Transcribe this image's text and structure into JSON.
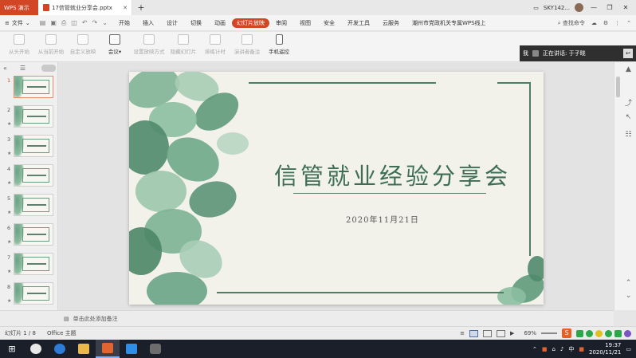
{
  "titlebar": {
    "app_name": "WPS 演示",
    "doc_tab": "17信管就业分享会.pptx",
    "user": "SKY142..."
  },
  "menu": {
    "file": "文件",
    "items": [
      "开始",
      "插入",
      "设计",
      "切换",
      "动画",
      "幻灯片放映",
      "审阅",
      "视图",
      "安全",
      "开发工具",
      "云服务",
      "潮州市党政机关专属WPS线上"
    ],
    "active_index": 5,
    "search": "查找命令"
  },
  "ribbon": {
    "buttons": [
      {
        "label": "从头开始",
        "enabled": false
      },
      {
        "label": "从当前开始",
        "enabled": false
      },
      {
        "label": "自定义放映",
        "enabled": false
      },
      {
        "label": "会议▾",
        "enabled": true
      },
      {
        "label": "设置放映方式",
        "enabled": false
      },
      {
        "label": "隐藏幻灯片",
        "enabled": false
      },
      {
        "label": "排练计时",
        "enabled": false
      },
      {
        "label": "演讲者备注",
        "enabled": false
      },
      {
        "label": "手机遥控",
        "enabled": true
      }
    ]
  },
  "speaker": {
    "me": "我",
    "label": "正在讲话: 于子晓"
  },
  "thumbnails": [
    {
      "num": "1"
    },
    {
      "num": "2"
    },
    {
      "num": "3"
    },
    {
      "num": "4"
    },
    {
      "num": "5"
    },
    {
      "num": "6"
    },
    {
      "num": "7"
    },
    {
      "num": "8"
    }
  ],
  "slide": {
    "title": "信管就业经验分享会",
    "date": "2020年11月21日"
  },
  "notes": {
    "placeholder": "单击此处添加备注"
  },
  "status": {
    "slide_info": "幻灯片 1 / 8",
    "theme": "Office 主题",
    "zoom": "69%"
  },
  "taskbar": {
    "time": "19:37",
    "date": "2020/11/21",
    "ime": "中"
  },
  "colors": {
    "accent": "#d24625",
    "leaf_green": "#4f7f63"
  }
}
